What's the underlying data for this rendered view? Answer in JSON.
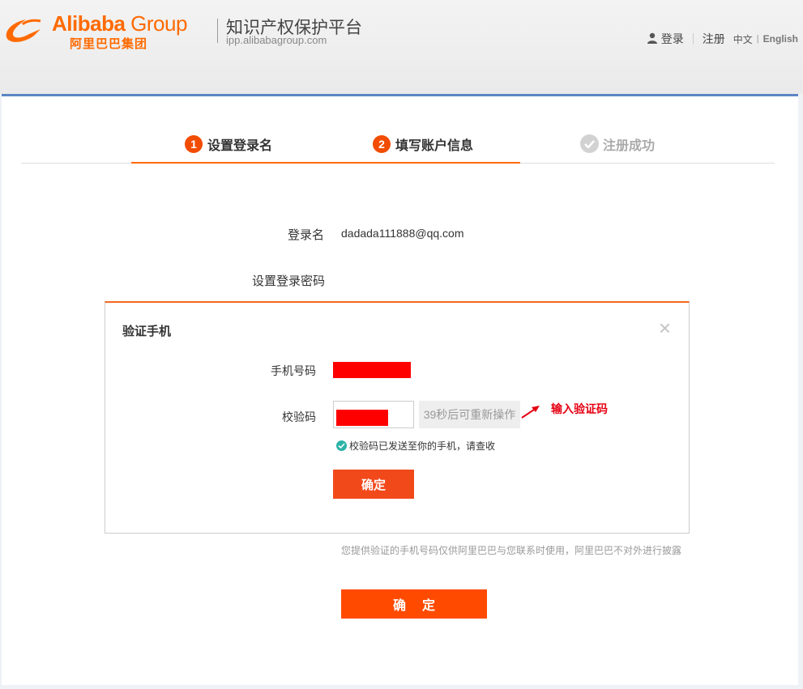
{
  "header": {
    "logo_en": "Alibaba",
    "logo_group": "Group",
    "logo_cn": "阿里巴巴集团",
    "site_title": "知识产权保护平台",
    "site_url": "ipp.alibabagroup.com",
    "login_label": "登录",
    "register_label": "注册",
    "lang_cn": "中文",
    "lang_sep": "|",
    "lang_en": "English",
    "brand_color": "#ff6a00"
  },
  "steps": [
    {
      "number": "1",
      "label": "设置登录名",
      "state": "active"
    },
    {
      "number": "2",
      "label": "填写账户信息",
      "state": "active"
    },
    {
      "number": "",
      "label": "注册成功",
      "state": "pending"
    }
  ],
  "form": {
    "login_name_label": "登录名",
    "login_name_value": "dadada111888@qq.com",
    "set_password_label": "设置登录密码",
    "privacy_note": "您提供验证的手机号码仅供阿里巴巴与您联系时使用，阿里巴巴不对外进行披露",
    "submit_label": "确定"
  },
  "dialog": {
    "title": "验证手机",
    "close_label": "×",
    "phone_label": "手机号码",
    "code_label": "校验码",
    "resend_label": "39秒后可重新操作",
    "sent_message": "校验码已发送至你的手机，请查收",
    "confirm_label": "确定"
  },
  "annotation": {
    "text": "输入验证码",
    "color": "#e60012"
  }
}
